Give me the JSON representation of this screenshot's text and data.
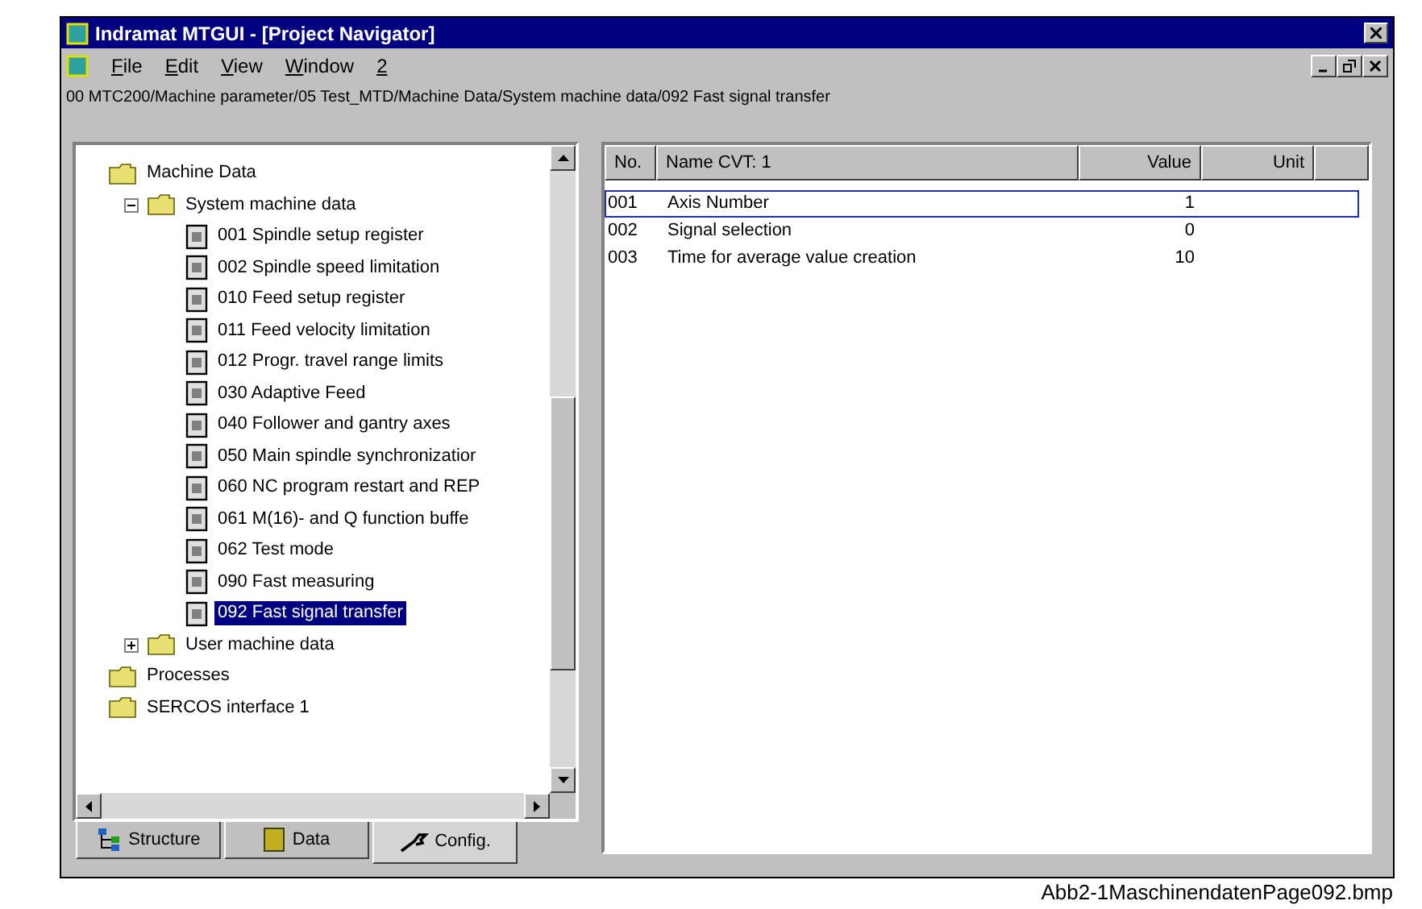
{
  "window": {
    "title": "Indramat MTGUI - [Project Navigator]"
  },
  "menu": [
    "File",
    "Edit",
    "View",
    "Window",
    "2"
  ],
  "path": "00 MTC200/Machine parameter/05 Test_MTD/Machine Data/System machine data/092 Fast signal transfer",
  "tree": [
    {
      "label": "Machine Data",
      "kind": "folder",
      "selected": false,
      "children": [
        {
          "label": "System machine data",
          "kind": "folder",
          "expanded": true,
          "selected": false,
          "children": [
            {
              "label": "001 Spindle setup register",
              "kind": "parameter",
              "selected": false
            },
            {
              "label": "002 Spindle speed limitation",
              "kind": "parameter",
              "selected": false
            },
            {
              "label": "010 Feed setup register",
              "kind": "parameter",
              "selected": false
            },
            {
              "label": "011 Feed velocity limitation",
              "kind": "parameter",
              "selected": false
            },
            {
              "label": "012 Progr. travel range limits",
              "kind": "parameter",
              "selected": false
            },
            {
              "label": "030 Adaptive Feed",
              "kind": "parameter",
              "selected": false
            },
            {
              "label": "040 Follower and gantry axes",
              "kind": "parameter",
              "selected": false
            },
            {
              "label": "050 Main spindle synchronizatior",
              "kind": "parameter",
              "selected": false
            },
            {
              "label": "060 NC program restart and REP",
              "kind": "parameter",
              "selected": false
            },
            {
              "label": "061 M(16)- and Q function buffe",
              "kind": "parameter",
              "selected": false
            },
            {
              "label": "062 Test mode",
              "kind": "parameter",
              "selected": false
            },
            {
              "label": "090 Fast measuring",
              "kind": "parameter",
              "selected": false
            },
            {
              "label": "092 Fast signal transfer",
              "kind": "parameter",
              "selected": true
            }
          ]
        },
        {
          "label": "User machine data",
          "kind": "folder",
          "expanded": false,
          "selected": false
        }
      ]
    },
    {
      "label": "Processes",
      "kind": "folder",
      "selected": false
    },
    {
      "label": "SERCOS interface 1",
      "kind": "folder",
      "selected": false
    }
  ],
  "tabs": [
    {
      "label": "Structure",
      "selected": false
    },
    {
      "label": "Data",
      "selected": false
    },
    {
      "label": "Config.",
      "selected": true
    }
  ],
  "table": {
    "columns": [
      "No.",
      "Name CVT: 1",
      "Value",
      "Unit"
    ],
    "rows": [
      {
        "no": "001",
        "name": "Axis Number",
        "value": "1",
        "selected": true
      },
      {
        "no": "002",
        "name": "Signal selection",
        "value": "0",
        "selected": false
      },
      {
        "no": "003",
        "name": "Time for average value creation",
        "value": "10",
        "selected": false
      }
    ]
  },
  "caption": "Abb2-1MaschinendatenPage092.bmp"
}
